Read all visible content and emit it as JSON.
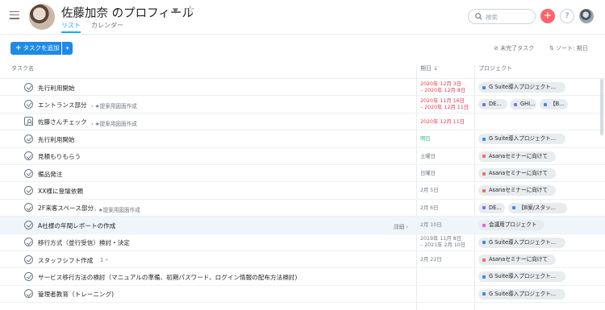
{
  "colors": {
    "accent": "#14aaf5",
    "primary_button": "#1e8ae8",
    "overdue": "#e8384f",
    "today": "#25b687",
    "add_circle": "#fc636b"
  },
  "header": {
    "title": "佐藤加奈 のプロフィール",
    "tabs": [
      {
        "label": "リスト",
        "active": true
      },
      {
        "label": "カレンダー",
        "active": false
      }
    ],
    "search_placeholder": "検索",
    "plus_icon": "+",
    "help_icon": "?"
  },
  "toolbar": {
    "add_task_label": "タスクを追加",
    "filter_label": "未完了タスク",
    "sort_label": "ソート: 期日"
  },
  "columns": {
    "task": "タスク名",
    "due": "期日",
    "project": "プロジェクト"
  },
  "project_colors": {
    "gsuite": "#4186e0",
    "de": "#7a6ff0",
    "ghi": "#7a6ff0",
    "b": "#4186e0",
    "asana": "#f06a6a",
    "bcase": "#4186e0",
    "meeting": "#e362e3"
  },
  "tasks": [
    {
      "icon": "check-icon",
      "name": "先行利用開始",
      "subtitle": "",
      "due": [
        "2020年 12月 3日",
        "– 2020年 12月 8日"
      ],
      "due_color": "red",
      "projects": [
        {
          "label": "G Suite導入プロジェクト...",
          "color": "#4186e0"
        }
      ]
    },
    {
      "icon": "check-icon",
      "name": "エントランス部分",
      "subtitle": "› ★提案用図面作成",
      "due": [
        "2020年 11月 16日",
        "– 2020年 12月 11日"
      ],
      "due_color": "red",
      "projects": [
        {
          "label": "DE...",
          "color": "#7a6ff0"
        },
        {
          "label": "GHI...",
          "color": "#7a6ff0"
        },
        {
          "label": "【B...",
          "color": "#4186e0"
        }
      ]
    },
    {
      "icon": "approval-icon",
      "name": "佐藤さんチェック",
      "subtitle": "› ★提案用図面作成",
      "due": [
        "2020年 12月 11日"
      ],
      "due_color": "red",
      "projects": []
    },
    {
      "icon": "check-icon",
      "name": "先行利用開始",
      "subtitle": "",
      "due": [
        "明日"
      ],
      "due_color": "green",
      "projects": [
        {
          "label": "G Suite導入プロジェクト...",
          "color": "#4186e0"
        }
      ]
    },
    {
      "icon": "check-icon",
      "name": "見積もりもらう",
      "subtitle": "",
      "due": [
        "土曜日"
      ],
      "due_color": "gray",
      "projects": [
        {
          "label": "Asanaセミナーに向けて",
          "color": "#f06a6a"
        }
      ]
    },
    {
      "icon": "check-icon",
      "name": "備品発注",
      "subtitle": "",
      "due": [
        "日曜日"
      ],
      "due_color": "gray",
      "projects": [
        {
          "label": "Asanaセミナーに向けて",
          "color": "#f06a6a"
        }
      ]
    },
    {
      "icon": "check-icon",
      "name": "XX様に登壇依頼",
      "subtitle": "",
      "due": [
        "2月 5日"
      ],
      "due_color": "gray",
      "projects": [
        {
          "label": "Asanaセミナーに向けて",
          "color": "#f06a6a"
        }
      ]
    },
    {
      "icon": "check-icon",
      "name": "2F来客スペース部分",
      "subtitle": "› ★提案用図面作成",
      "due": [
        "2月 6日"
      ],
      "due_color": "gray",
      "projects": [
        {
          "label": "DE...",
          "color": "#7a6ff0"
        },
        {
          "label": "【B案/スタッ...",
          "color": "#4186e0"
        }
      ]
    },
    {
      "icon": "check-icon",
      "name": "A社様の年間レポートの作成",
      "subtitle": "",
      "detail": "詳細 ›",
      "due": [
        "2月 10日"
      ],
      "due_color": "gray",
      "projects": [
        {
          "label": "会議用プロジェクト",
          "color": "#e362e3"
        }
      ]
    },
    {
      "icon": "check-icon",
      "name": "移行方式（並行受信）検討・決定",
      "subtitle": "",
      "due": [
        "2019年 11月 8日",
        "– 2021年 2月 10日"
      ],
      "due_color": "gray",
      "projects": [
        {
          "label": "G Suite導入プロジェクト...",
          "color": "#4186e0"
        }
      ]
    },
    {
      "icon": "check-icon",
      "name": "スタッフシフト作成",
      "subtitle": "",
      "subtask_count": "1 ⑂",
      "due": [
        "2月 22日"
      ],
      "due_color": "gray",
      "projects": [
        {
          "label": "Asanaセミナーに向けて",
          "color": "#f06a6a"
        }
      ]
    },
    {
      "icon": "check-icon",
      "name": "サービス移行方法の検討（マニュアルの準備、初期パスワード、ログイン情報の配布方法検討)",
      "subtitle": "",
      "due": [],
      "due_color": "gray",
      "projects": [
        {
          "label": "G Suite導入プロジェクト...",
          "color": "#4186e0"
        }
      ]
    },
    {
      "icon": "check-icon",
      "name": "管理者教育（トレーニング)",
      "subtitle": "",
      "due": [],
      "due_color": "gray",
      "projects": [
        {
          "label": "G Suite導入プロジェクト...",
          "color": "#4186e0"
        }
      ]
    }
  ]
}
